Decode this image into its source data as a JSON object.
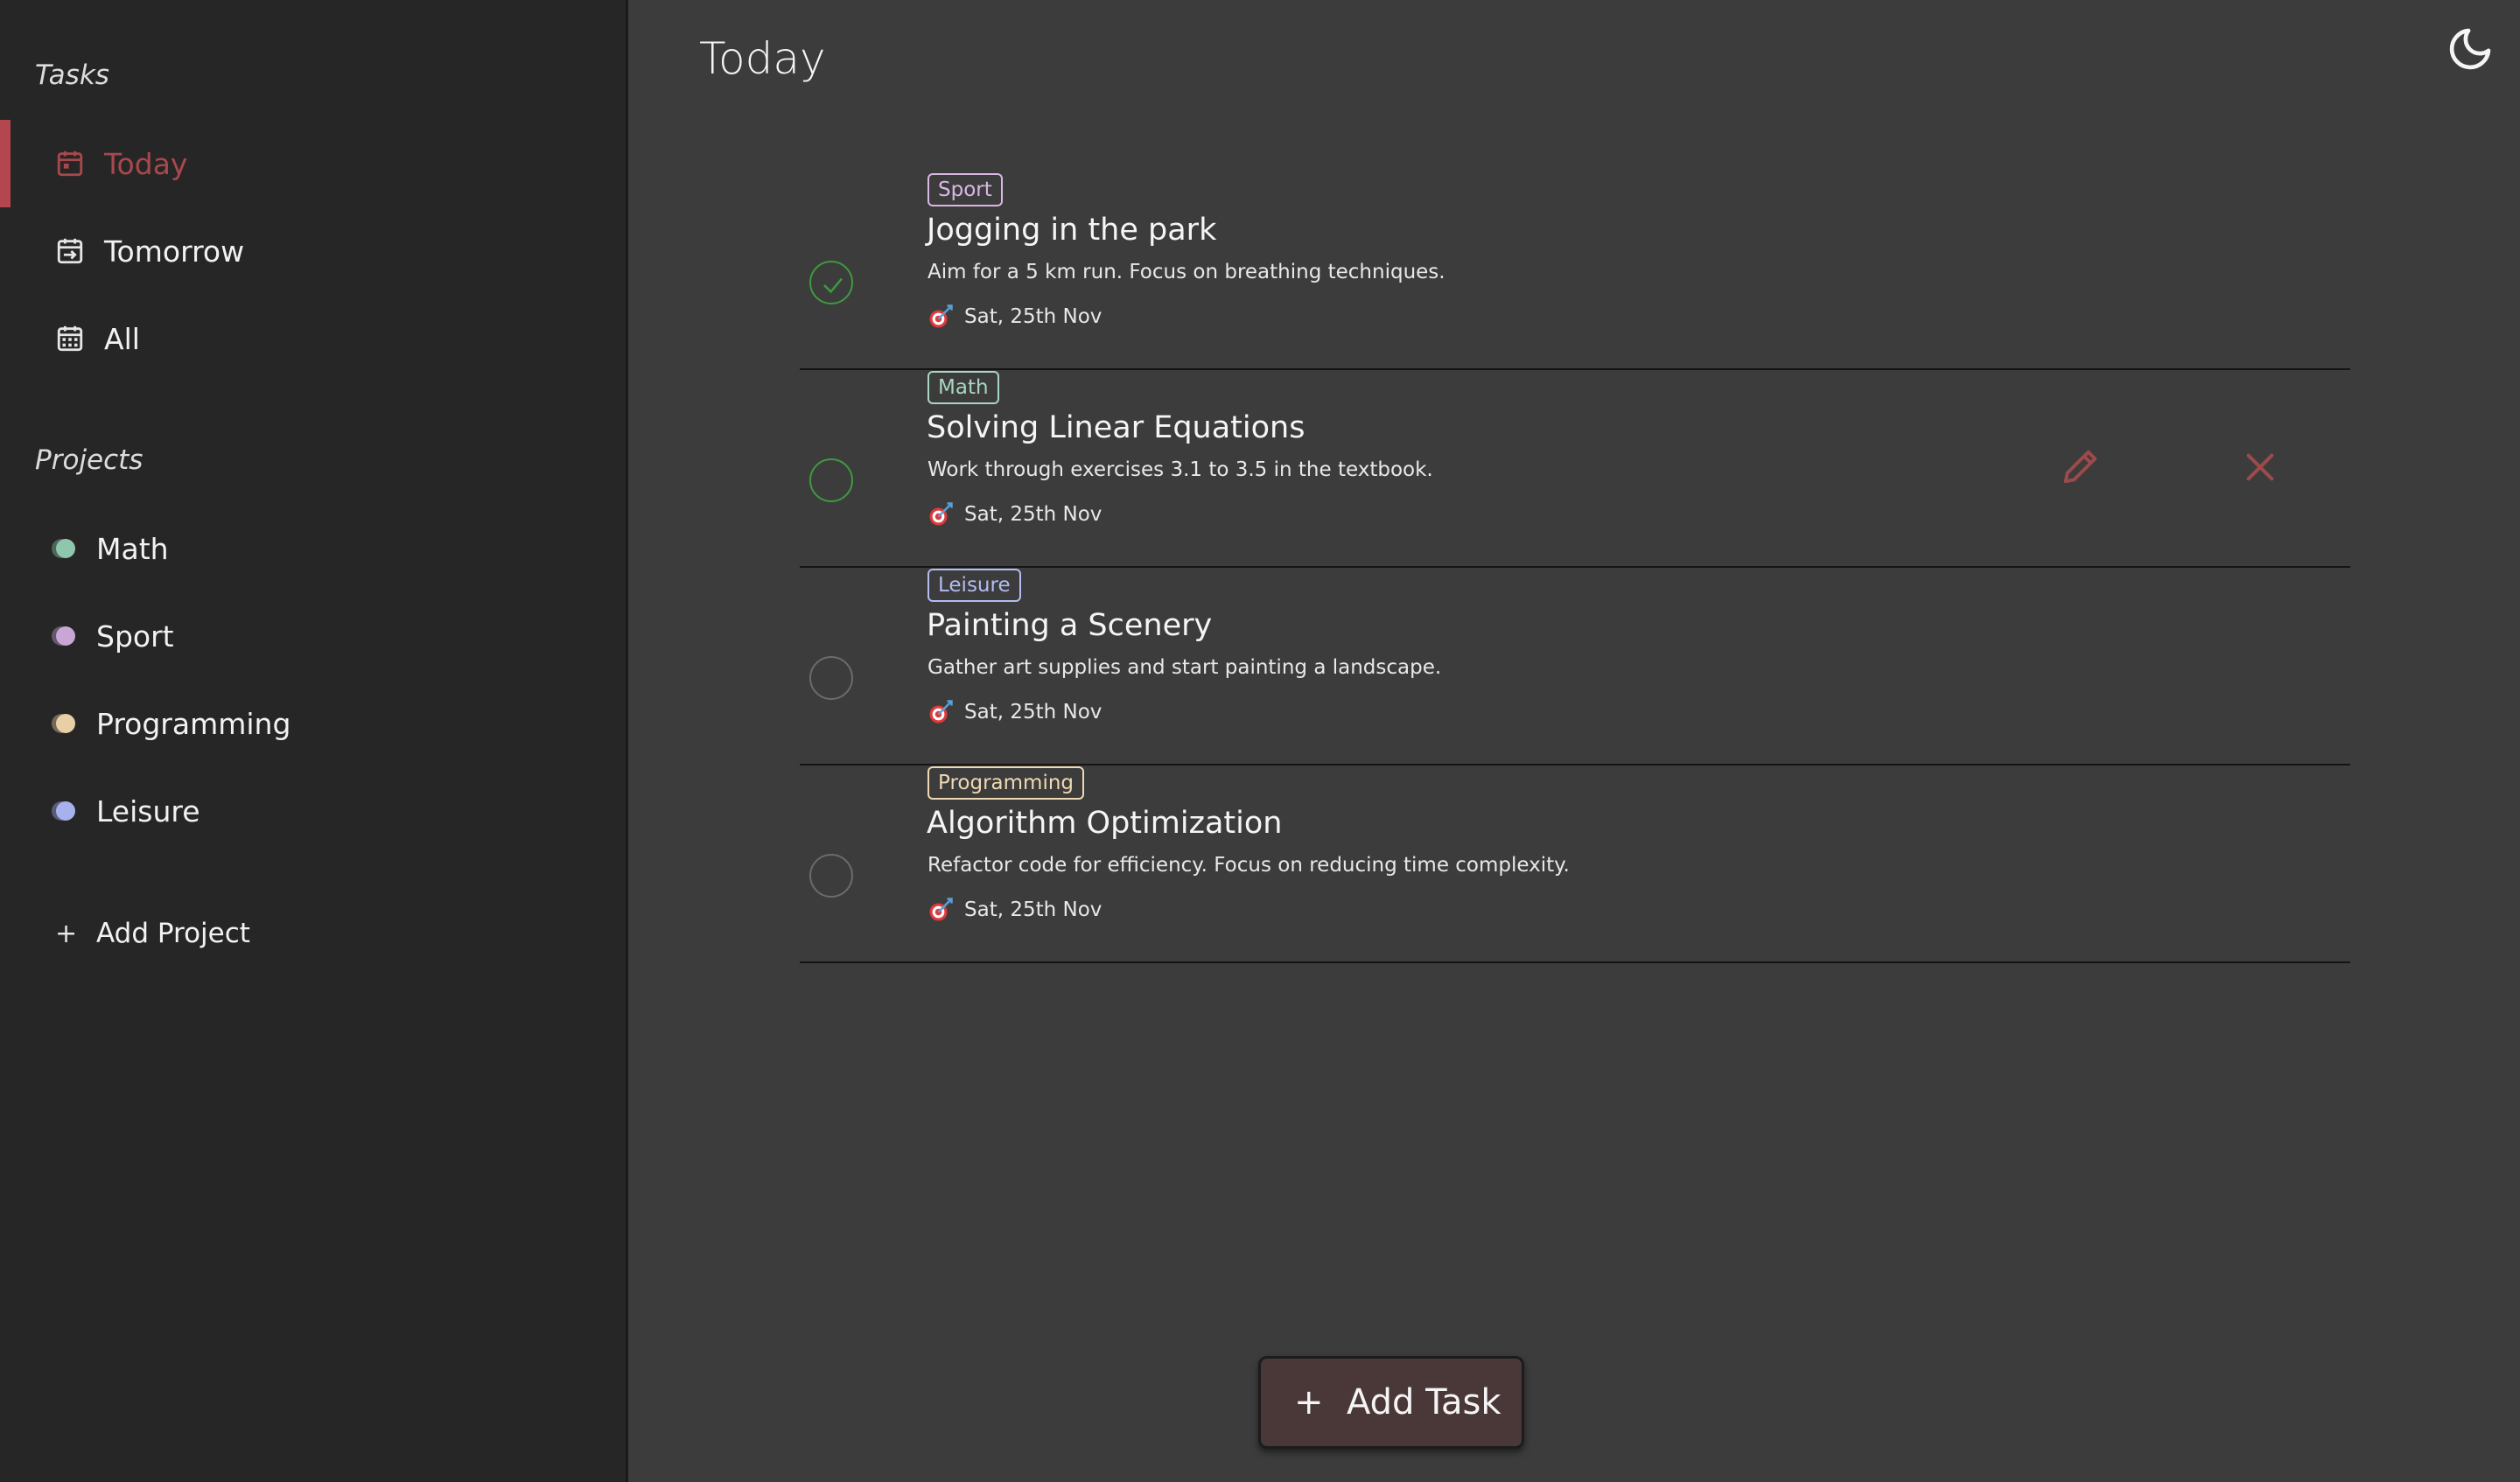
{
  "sidebar": {
    "tasks_heading": "Tasks",
    "nav": [
      {
        "label": "Today",
        "icon": "calendar-today-icon",
        "active": true
      },
      {
        "label": "Tomorrow",
        "icon": "calendar-next-icon",
        "active": false
      },
      {
        "label": "All",
        "icon": "calendar-all-icon",
        "active": false
      }
    ],
    "projects_heading": "Projects",
    "projects": [
      {
        "label": "Math",
        "color": "#8fc7ad"
      },
      {
        "label": "Sport",
        "color": "#c9a6d6"
      },
      {
        "label": "Programming",
        "color": "#e8cfa6"
      },
      {
        "label": "Leisure",
        "color": "#a6b1ee"
      }
    ],
    "add_project": {
      "icon": "+",
      "label": "Add Project"
    }
  },
  "header": {
    "title": "Today",
    "theme_toggle_icon": "moon-icon"
  },
  "tasks": [
    {
      "tag": "Sport",
      "tag_color": "#d8b8e3",
      "title": "Jogging in the park",
      "description": "Aim for a 5 km run. Focus on breathing techniques.",
      "due": "Sat, 25th Nov",
      "completed": true
    },
    {
      "tag": "Math",
      "tag_color": "#a9d6c1",
      "title": "Solving Linear Equations",
      "description": "Work through exercises 3.1 to 3.5 in the textbook.",
      "due": "Sat, 25th Nov",
      "completed": false,
      "hovered": true
    },
    {
      "tag": "Leisure",
      "tag_color": "#b3bdf2",
      "title": "Painting a Scenery",
      "description": "Gather art supplies and start painting a landscape.",
      "due": "Sat, 25th Nov",
      "completed": false
    },
    {
      "tag": "Programming",
      "tag_color": "#efd9b3",
      "title": "Algorithm Optimization",
      "description": "Refactor code for efficiency. Focus on reducing time complexity.",
      "due": "Sat, 25th Nov",
      "completed": false
    }
  ],
  "task_actions": {
    "edit_icon": "pencil-icon",
    "delete_icon": "close-icon",
    "color": "#9e4a4a"
  },
  "add_task": {
    "icon": "+",
    "label": "Add Task"
  },
  "colors": {
    "accent": "#b3474f",
    "sidebar_bg": "#262626",
    "main_bg": "#3c3c3c",
    "done_green": "#3f9a3f"
  }
}
